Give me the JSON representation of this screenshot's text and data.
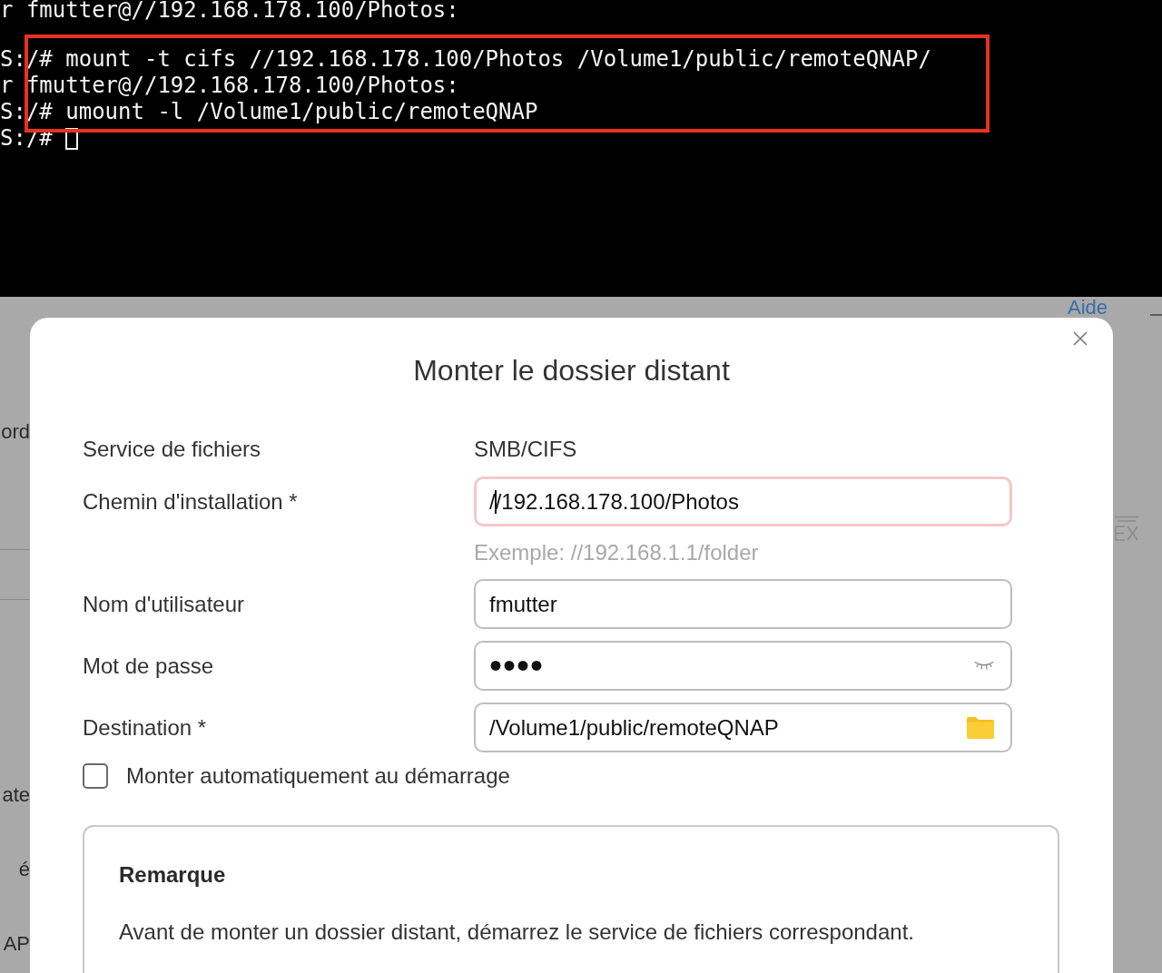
{
  "terminal": {
    "lines": [
      {
        "kind": "text",
        "text": "r fmutter@//192.168.178.100/Photos:",
        "highlighted": false,
        "cursor": false
      },
      {
        "kind": "blank",
        "highlighted": false,
        "cursor": false
      },
      {
        "kind": "text",
        "text": "S:/# mount -t cifs //192.168.178.100/Photos /Volume1/public/remoteQNAP/",
        "highlighted": true,
        "cursor": false
      },
      {
        "kind": "text",
        "text": "r fmutter@//192.168.178.100/Photos:",
        "highlighted": true,
        "cursor": false
      },
      {
        "kind": "text",
        "text": "S:/# umount -l /Volume1/public/remoteQNAP",
        "highlighted": true,
        "cursor": false
      },
      {
        "kind": "text",
        "text": "S:/#",
        "highlighted": false,
        "cursor": true
      }
    ]
  },
  "background_page": {
    "help_link": "Aide",
    "left_labels": [
      "ord",
      "ate",
      "é",
      "AP"
    ]
  },
  "dialog": {
    "title": "Monter le dossier distant",
    "fields": [
      {
        "kind": "static",
        "label": "Service de fichiers",
        "value": "SMB/CIFS"
      },
      {
        "kind": "text",
        "label": "Chemin d'installation *",
        "value": "//192.168.178.100/Photos",
        "focused": true,
        "hint": "Exemple: //192.168.1.1/folder"
      },
      {
        "kind": "text",
        "label": "Nom d'utilisateur",
        "value": "fmutter",
        "focused": false
      },
      {
        "kind": "password",
        "label": "Mot de passe",
        "value": "••••",
        "focused": false
      },
      {
        "kind": "folder",
        "label": "Destination *",
        "value": "/Volume1/public/remoteQNAP",
        "focused": false
      }
    ],
    "auto_mount": {
      "label": "Monter automatiquement au démarrage",
      "checked": false
    },
    "note": {
      "title": "Remarque",
      "text": "Avant de monter un dossier distant, démarrez le service de fichiers correspondant."
    }
  }
}
